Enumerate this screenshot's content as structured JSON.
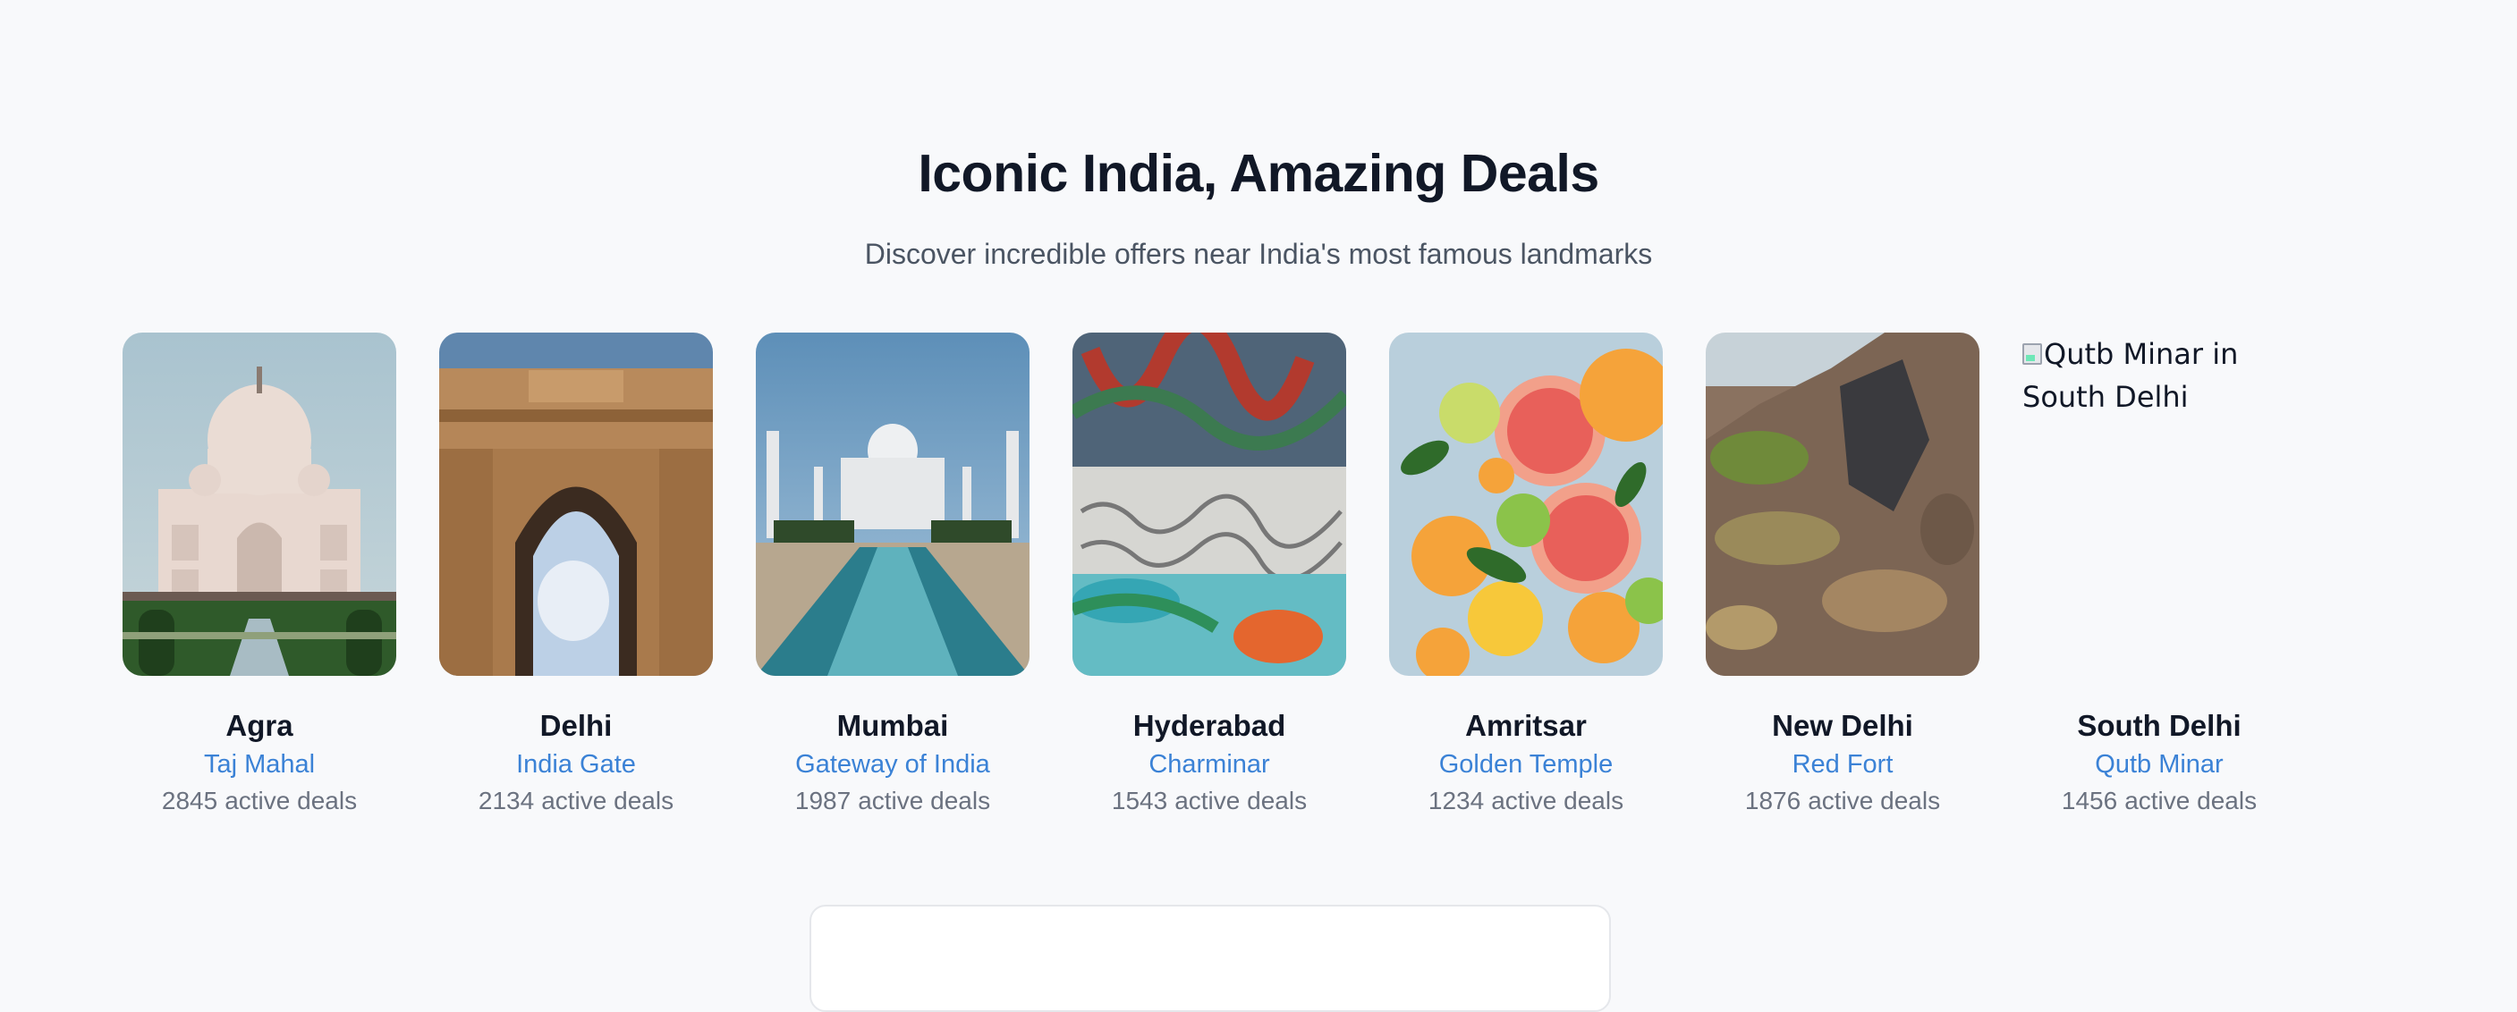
{
  "section": {
    "title": "Iconic India, Amazing Deals",
    "subtitle": "Discover incredible offers near India's most famous landmarks"
  },
  "cities": [
    {
      "city": "Agra",
      "landmark": "Taj Mahal",
      "deal_count": "2845",
      "deals_suffix": "active deals",
      "image": "taj-mahal-photo"
    },
    {
      "city": "Delhi",
      "landmark": "India Gate",
      "deal_count": "2134",
      "deals_suffix": "active deals",
      "image": "india-gate-photo"
    },
    {
      "city": "Mumbai",
      "landmark": "Gateway of India",
      "deal_count": "1987",
      "deals_suffix": "active deals",
      "image": "taj-mahal-reflecting-pool-photo"
    },
    {
      "city": "Hyderabad",
      "landmark": "Charminar",
      "deal_count": "1543",
      "deals_suffix": "active deals",
      "image": "graffiti-wall-photo"
    },
    {
      "city": "Amritsar",
      "landmark": "Golden Temple",
      "deal_count": "1234",
      "deals_suffix": "active deals",
      "image": "citrus-fruits-photo"
    },
    {
      "city": "New Delhi",
      "landmark": "Red Fort",
      "deal_count": "1876",
      "deals_suffix": "active deals",
      "image": "rocky-hillside-photo"
    },
    {
      "city": "South Delhi",
      "landmark": "Qutb Minar",
      "deal_count": "1456",
      "deals_suffix": "active deals",
      "image_alt": "Qutb Minar in South Delhi",
      "image": "broken-image-icon"
    }
  ],
  "colors": {
    "background": "#f8f9fb",
    "title": "#111827",
    "subtitle": "#4b5563",
    "landmark_link": "#3b82d6",
    "deals_text": "#6b7280"
  }
}
